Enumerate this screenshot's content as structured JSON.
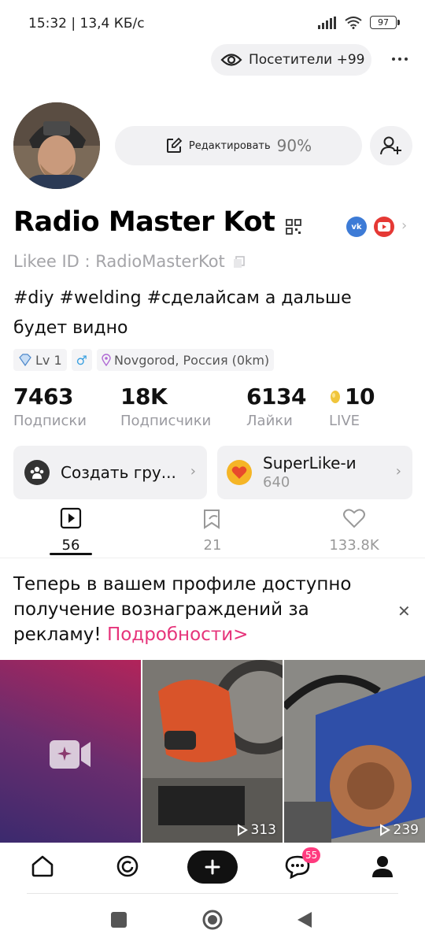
{
  "status_bar": {
    "time": "15:32 | 13,4 КБ/с",
    "battery": "97"
  },
  "header": {
    "visitors_label": "Посетители +99"
  },
  "profile": {
    "edit_label": "Редактировать",
    "edit_percent": "90%",
    "name": "Radio Master Kot",
    "social_vk": "vk",
    "likee_id": "Likee ID : RadioMasterKot",
    "bio_line1": "#diy #welding #сделайсам а дальше",
    "bio_line2": "будет видно",
    "level": "Lv 1",
    "gender_symbol": "♂",
    "location": "Novgorod, Россия (0km)"
  },
  "stats": [
    {
      "value": "7463",
      "label": "Подписки"
    },
    {
      "value": "18K",
      "label": "Подписчики"
    },
    {
      "value": "6134",
      "label": "Лайки"
    },
    {
      "value": "10",
      "label": "LIVE"
    }
  ],
  "cards": {
    "group_label": "Создать гру...",
    "superlike_label": "SuperLike-и",
    "superlike_count": "640"
  },
  "tabs": [
    {
      "count": "56",
      "icon": "video-icon"
    },
    {
      "count": "21",
      "icon": "tag-icon"
    },
    {
      "count": "133.8K",
      "icon": "heart-icon"
    }
  ],
  "notice": {
    "text": "Теперь в вашем профиле доступно получение вознаграждений за рекламу! ",
    "link": "Подробности>"
  },
  "videos": [
    {
      "views": ""
    },
    {
      "views": "313"
    },
    {
      "views": "239"
    }
  ],
  "bottom_nav": {
    "messages_badge": "55"
  },
  "colors": {
    "accent_pink": "#e6337a",
    "badge_pink": "#ff3b7f",
    "vk_blue": "#3d7bd6",
    "youtube_red": "#e53935"
  }
}
